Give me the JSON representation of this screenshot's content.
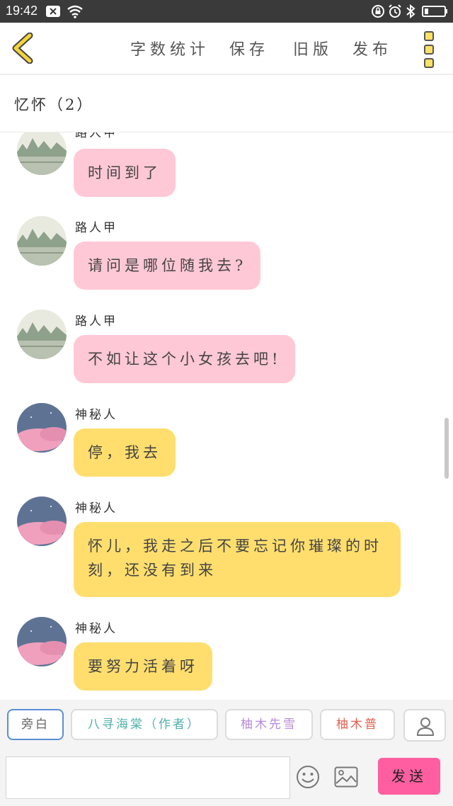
{
  "status_bar": {
    "time": "19:42"
  },
  "toolbar": {
    "word_count": "字数统计",
    "save": "保存",
    "old_version": "旧版",
    "publish": "发布"
  },
  "title": "忆怀（2）",
  "messages": [
    {
      "name": "路人甲",
      "text": "时间到了",
      "color": "#ffc8d6"
    },
    {
      "name": "路人甲",
      "text": "请问是哪位随我去?",
      "color": "#ffc8d6"
    },
    {
      "name": "路人甲",
      "text": "不如让这个小女孩去吧!",
      "color": "#ffc8d6"
    },
    {
      "name": "神秘人",
      "text": "停，我去",
      "color": "#ffde6e"
    },
    {
      "name": "神秘人",
      "text": "怀儿，我走之后不要忘记你璀璨的时刻，还没有到来",
      "color": "#ffde6e"
    },
    {
      "name": "神秘人",
      "text": "要努力活着呀",
      "color": "#ffde6e"
    }
  ],
  "roles": [
    {
      "label": "旁白"
    },
    {
      "label": "八寻海棠（作者）"
    },
    {
      "label": "柚木先雪"
    },
    {
      "label": "柚木普"
    }
  ],
  "input": {
    "placeholder": ""
  },
  "send_label": "发送",
  "colors": {
    "accent_send": "#ff5fa0",
    "bubble_pink": "#ffc8d6",
    "bubble_yellow": "#ffde6e",
    "back_arrow": "#f5d33a"
  },
  "icons": [
    "back-arrow-icon",
    "more-menu-icon",
    "person-icon",
    "emoji-icon",
    "image-icon"
  ]
}
